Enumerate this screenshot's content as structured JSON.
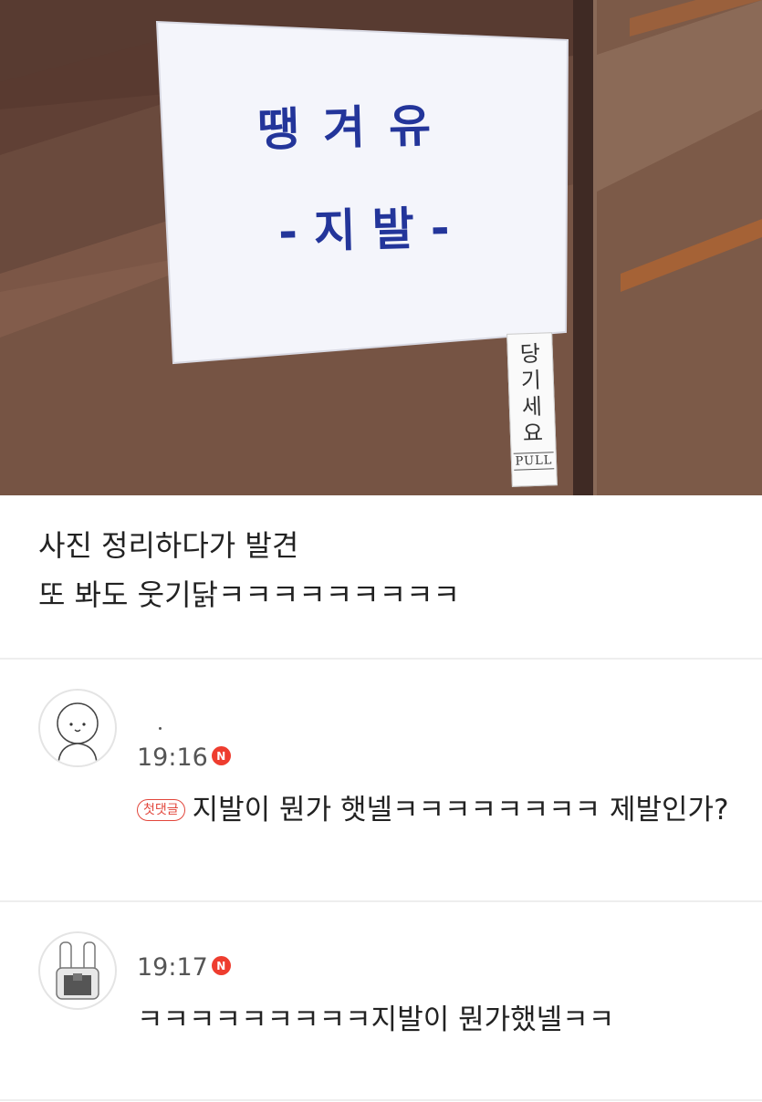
{
  "photo": {
    "sign_line1": "땡겨유",
    "sign_line2": "-지발-",
    "pull_sticker_chars": [
      "당",
      "기",
      "세",
      "요"
    ],
    "pull_sticker_en": "PULL",
    "colors": {
      "sign_text": "#23359a",
      "door": "#5b3d33"
    }
  },
  "post": {
    "lines": [
      "사진 정리하다가 발견",
      "또 봐도 웃기닭ㅋㅋㅋㅋㅋㅋㅋㅋㅋ"
    ]
  },
  "comments": [
    {
      "avatar_icon": "smiley-character-icon",
      "time": "19:16",
      "new_badge": "N",
      "first_badge": "첫댓글",
      "text": "지발이 뭔가 햇넬ㅋㅋㅋㅋㅋㅋㅋㅋ 제발인가?"
    },
    {
      "avatar_icon": "bunny-character-icon",
      "time": "19:17",
      "new_badge": "N",
      "text": "ㅋㅋㅋㅋㅋㅋㅋㅋㅋ지발이 뭔가했넬ㅋㅋ"
    }
  ],
  "colors": {
    "new_badge": "#ee3d2f",
    "first_badge": "#e2463b",
    "divider": "#eeeeee"
  }
}
